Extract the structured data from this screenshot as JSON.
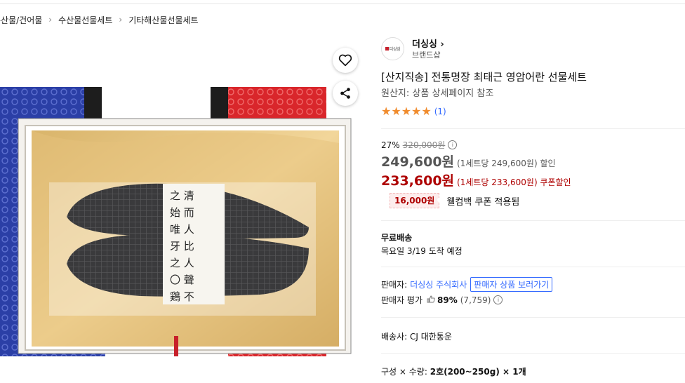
{
  "breadcrumb": [
    "수산물/건어물",
    "수산물선물세트",
    "기타해산물선물세트"
  ],
  "image": {
    "alt": "",
    "wrap_text": "清而人 比人 聲不 之 始 唯 牙 之 〇 鶏 真 而 玉 齊 見"
  },
  "brand": {
    "logo_text": "더싱싱",
    "name": "더싱싱",
    "shop_label": "브랜드샵"
  },
  "product": {
    "title": "[산지직송] 전통명장 최태근 영암어란 선물세트",
    "origin": "원산지: 상품 상세페이지 참조",
    "rating_stars": 5,
    "review_count": "(1)"
  },
  "price": {
    "discount_rate": "27%",
    "original_price": "320,000원",
    "sale_price": "249,600원",
    "sale_note": "(1세트당 249,600원) 할인",
    "coupon_price": "233,600원",
    "coupon_note": "(1세트당 233,600원) 쿠폰할인",
    "coupon_amount": "16,000원",
    "coupon_text": "웰컴백 쿠폰 적용됨"
  },
  "shipping": {
    "title": "무료배송",
    "arrival": "목요일 3/19 도착 예정"
  },
  "seller": {
    "label": "판매자:",
    "name": "더싱싱 주식회사",
    "button": "판매자 상품 보러가기",
    "rating_label": "판매자 평가",
    "rating_pct": "89%",
    "rating_count": "(7,759)"
  },
  "carrier": "배송사:  CJ 대한통운",
  "option": {
    "label": "구성 × 수량:",
    "value": "2호(200~250g) × 1개"
  },
  "colors": {
    "link": "#346aff",
    "price_red": "#ae0000",
    "star": "#f08b2c"
  }
}
